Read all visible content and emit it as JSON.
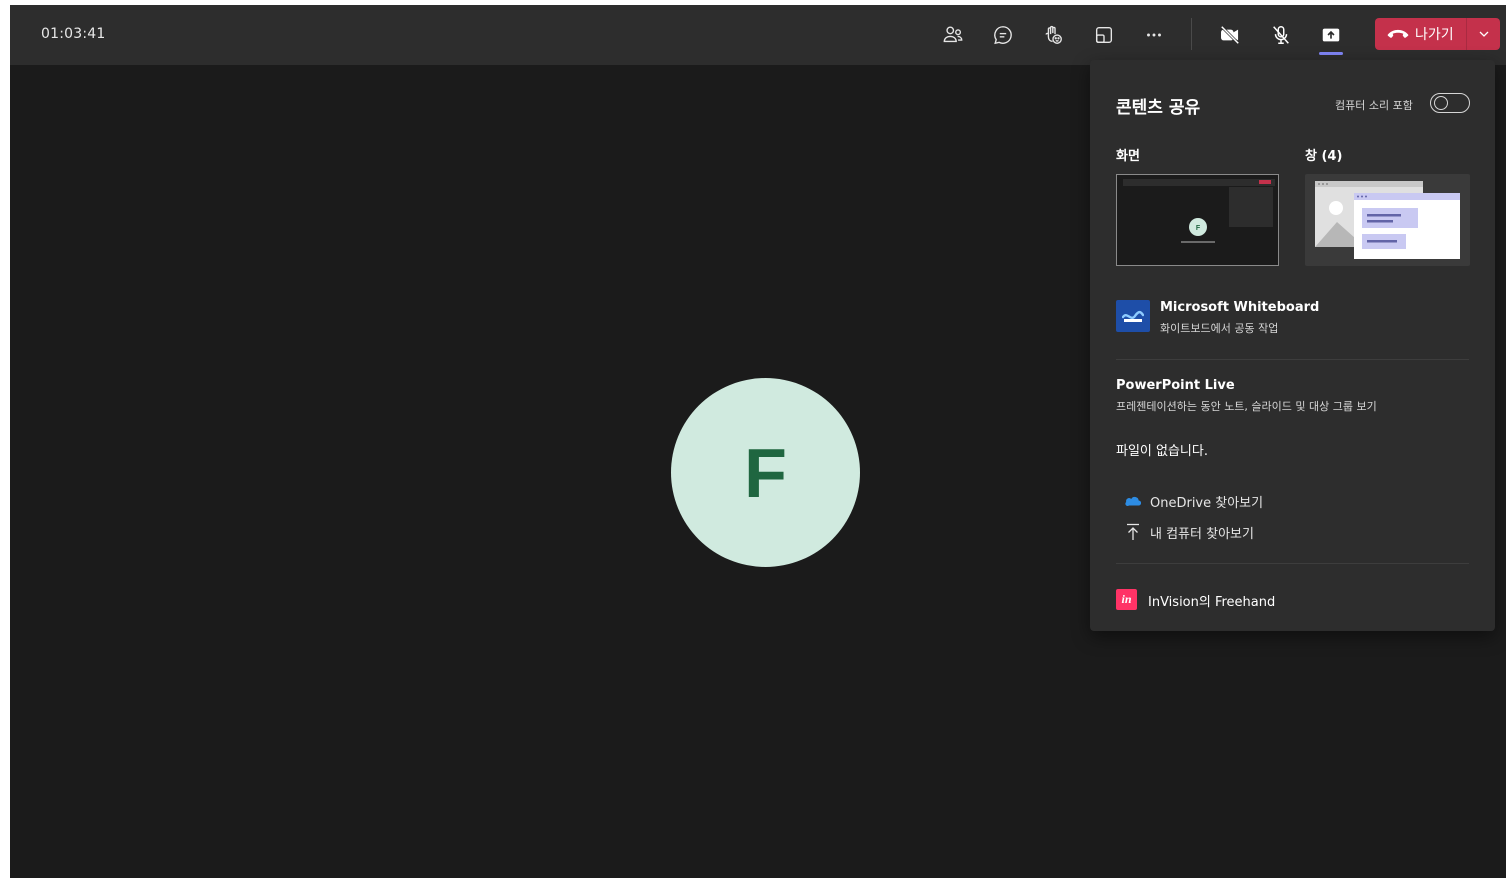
{
  "meeting": {
    "timer": "01:03:41",
    "participant_initial": "F",
    "avatar_color": "#d0eadf",
    "avatar_letter_color": "#1f6640"
  },
  "toolbar": {
    "icons": [
      "people-icon",
      "chat-icon",
      "raise-hand-icon",
      "view-icon",
      "more-icon",
      "camera-off-icon",
      "mic-off-icon",
      "share-screen-icon"
    ],
    "leave_label": "나가기",
    "leave_color": "#c4314b",
    "active_indicator_color": "#7f85f5"
  },
  "share_panel": {
    "title": "콘텐츠 공유",
    "include_audio_label": "컴퓨터 소리 포함",
    "include_audio_on": false,
    "screen_label": "화면",
    "window_label": "창 (4)",
    "whiteboard": {
      "title": "Microsoft Whiteboard",
      "subtitle": "화이트보드에서 공동 작업"
    },
    "powerpoint": {
      "title": "PowerPoint Live",
      "subtitle": "프레젠테이션하는 동안 노트, 슬라이드 및 대상 그룹 보기",
      "no_files": "파일이 없습니다."
    },
    "browse": {
      "onedrive": "OneDrive 찾아보기",
      "computer": "내 컴퓨터 찾아보기"
    },
    "invision": {
      "label": "InVision의 Freehand",
      "icon_text": "in"
    }
  }
}
